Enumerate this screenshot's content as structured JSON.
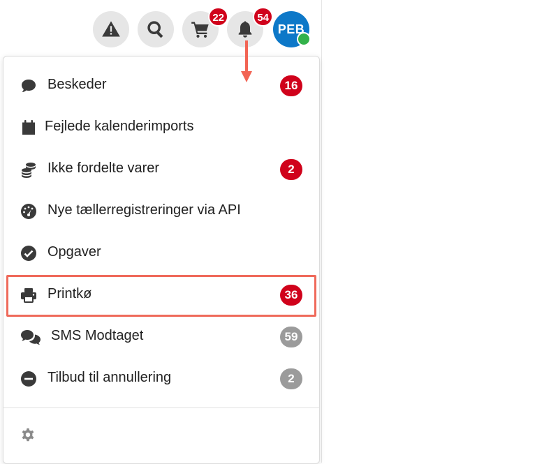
{
  "header": {
    "alert_icon": "warning-triangle-icon",
    "search_icon": "search-icon",
    "cart_count": "22",
    "bell_count": "54",
    "avatar_initials": "PEB"
  },
  "menu": {
    "items": [
      {
        "label": "Beskeder",
        "icon": "speech-bubble-icon",
        "badge": "16",
        "badge_color": "#d0021b"
      },
      {
        "label": "Fejlede kalenderimports",
        "icon": "calendar-icon",
        "badge": "",
        "badge_color": ""
      },
      {
        "label": "Ikke fordelte varer",
        "icon": "coins-stack-icon",
        "badge": "2",
        "badge_color": "#d0021b"
      },
      {
        "label": "Nye tællerregistreringer via API",
        "icon": "gauge-icon",
        "badge": "",
        "badge_color": ""
      },
      {
        "label": "Opgaver",
        "icon": "check-circle-icon",
        "badge": "",
        "badge_color": ""
      },
      {
        "label": "Printkø",
        "icon": "printer-icon",
        "badge": "36",
        "badge_color": "#d0021b"
      },
      {
        "label": "SMS Modtaget",
        "icon": "chat-bubbles-icon",
        "badge": "59",
        "badge_color": "#9b9b9b"
      },
      {
        "label": "Tilbud til annullering",
        "icon": "minus-circle-icon",
        "badge": "2",
        "badge_color": "#9b9b9b"
      }
    ],
    "settings_icon": "gear-icon"
  },
  "annotation": {
    "arrow_color": "#f26454",
    "highlight_color": "#ef6a5b"
  }
}
